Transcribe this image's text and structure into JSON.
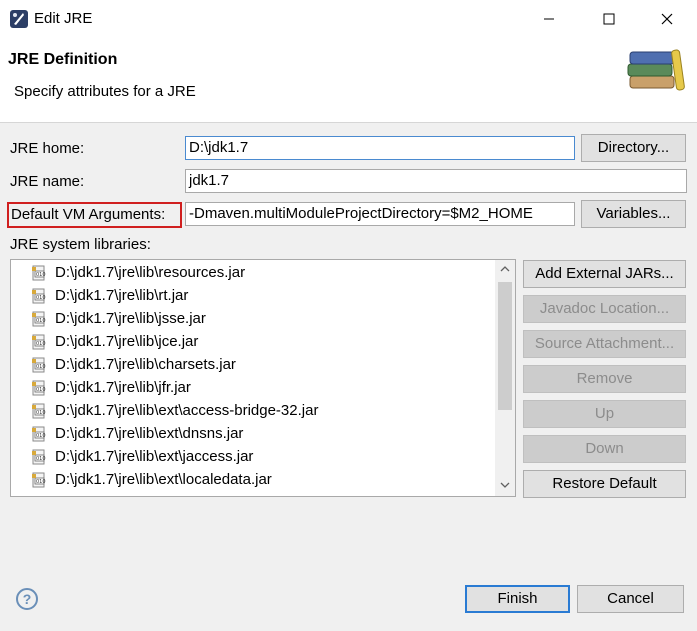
{
  "window": {
    "title": "Edit JRE",
    "min_icon": "minimize-icon",
    "max_icon": "maximize-icon",
    "close_icon": "close-icon"
  },
  "header": {
    "title": "JRE Definition",
    "subtitle": "Specify attributes for a JRE"
  },
  "form": {
    "jre_home_label": "JRE home:",
    "jre_home_value": "D:\\jdk1.7",
    "directory_button": "Directory...",
    "jre_name_label": "JRE name:",
    "jre_name_value": "jdk1.7",
    "vm_args_label": "Default VM Arguments:",
    "vm_args_value": "-Dmaven.multiModuleProjectDirectory=$M2_HOME",
    "variables_button": "Variables...",
    "libraries_label": "JRE system libraries:"
  },
  "libraries": [
    "D:\\jdk1.7\\jre\\lib\\resources.jar",
    "D:\\jdk1.7\\jre\\lib\\rt.jar",
    "D:\\jdk1.7\\jre\\lib\\jsse.jar",
    "D:\\jdk1.7\\jre\\lib\\jce.jar",
    "D:\\jdk1.7\\jre\\lib\\charsets.jar",
    "D:\\jdk1.7\\jre\\lib\\jfr.jar",
    "D:\\jdk1.7\\jre\\lib\\ext\\access-bridge-32.jar",
    "D:\\jdk1.7\\jre\\lib\\ext\\dnsns.jar",
    "D:\\jdk1.7\\jre\\lib\\ext\\jaccess.jar",
    "D:\\jdk1.7\\jre\\lib\\ext\\localedata.jar"
  ],
  "library_buttons": {
    "add_external": "Add External JARs...",
    "javadoc": "Javadoc Location...",
    "source": "Source Attachment...",
    "remove": "Remove",
    "up": "Up",
    "down": "Down",
    "restore": "Restore Default"
  },
  "footer": {
    "finish": "Finish",
    "cancel": "Cancel",
    "help": "?"
  },
  "colors": {
    "highlight": "#d01f1f",
    "primary_border": "#2a7bd3"
  }
}
